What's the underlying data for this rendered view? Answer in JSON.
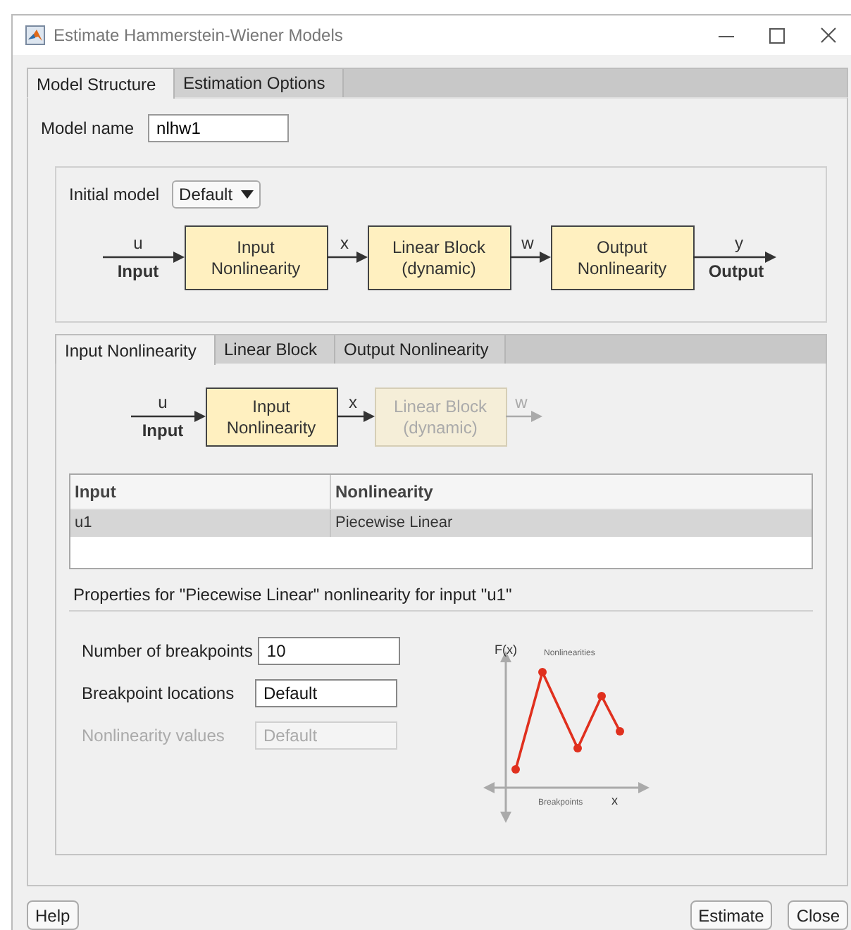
{
  "window": {
    "title": "Estimate Hammerstein-Wiener Models"
  },
  "tabs": [
    {
      "label": "Model Structure",
      "selected": true
    },
    {
      "label": "Estimation Options",
      "selected": false
    }
  ],
  "model_name": {
    "label": "Model name",
    "value": "nlhw1"
  },
  "initial_model": {
    "label": "Initial model",
    "value": "Default"
  },
  "diagram": {
    "input_signal": "u",
    "input_label": "Input",
    "output_label": "Output",
    "blocks": [
      {
        "lines": [
          "Input",
          "Nonlinearity"
        ],
        "out_signal": "x",
        "disabled": false
      },
      {
        "lines": [
          "Linear Block",
          "(dynamic)"
        ],
        "out_signal": "w",
        "disabled": false
      },
      {
        "lines": [
          "Output",
          "Nonlinearity"
        ],
        "out_signal": "y",
        "disabled": false
      }
    ]
  },
  "sub_tabs": [
    {
      "label": "Input Nonlinearity",
      "selected": true
    },
    {
      "label": "Linear Block",
      "selected": false
    },
    {
      "label": "Output Nonlinearity",
      "selected": false
    }
  ],
  "sub_diagram": {
    "input_signal": "u",
    "input_label": "Input",
    "blocks": [
      {
        "lines": [
          "Input",
          "Nonlinearity"
        ],
        "out_signal": "x",
        "disabled": false
      },
      {
        "lines": [
          "Linear Block",
          "(dynamic)"
        ],
        "out_signal": "w",
        "disabled": true
      }
    ]
  },
  "table": {
    "columns": [
      "Input",
      "Nonlinearity"
    ],
    "rows": [
      {
        "cells": [
          "u1",
          "Piecewise Linear"
        ],
        "selected": true
      }
    ]
  },
  "properties_title": "Properties for \"Piecewise Linear\" nonlinearity for input \"u1\"",
  "fields": [
    {
      "label": "Number of breakpoints",
      "value": "10",
      "disabled": false
    },
    {
      "label": "Breakpoint locations",
      "value": "Default",
      "disabled": false
    },
    {
      "label": "Nonlinearity values",
      "value": "Default",
      "disabled": true
    }
  ],
  "sketch": {
    "y_label": "F(x)",
    "title": "Nonlinearities",
    "x_caption": "Breakpoints",
    "x_label": "x"
  },
  "buttons_left": [
    "Help"
  ],
  "buttons_right": [
    "Estimate",
    "Close"
  ]
}
